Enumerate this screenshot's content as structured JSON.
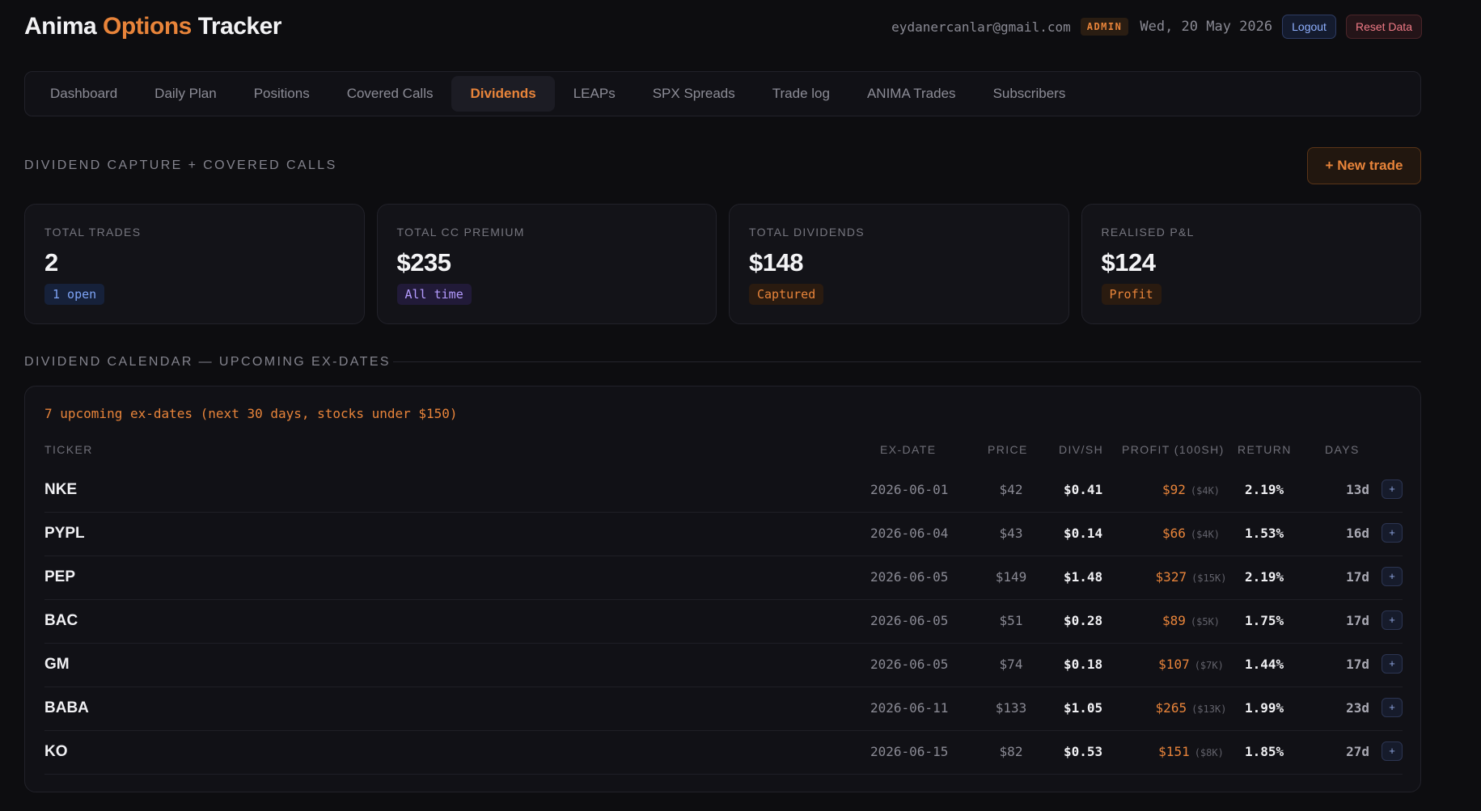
{
  "header": {
    "brand_part1": "Anima",
    "brand_part2": "Options",
    "brand_part3": "Tracker",
    "email": "eydanercanlar@gmail.com",
    "role_badge": "ADMIN",
    "date": "Wed, 20 May 2026",
    "logout_label": "Logout",
    "reset_label": "Reset Data"
  },
  "nav": {
    "tabs": [
      {
        "label": "Dashboard"
      },
      {
        "label": "Daily Plan"
      },
      {
        "label": "Positions"
      },
      {
        "label": "Covered Calls"
      },
      {
        "label": "Dividends",
        "active": true
      },
      {
        "label": "LEAPs"
      },
      {
        "label": "SPX Spreads"
      },
      {
        "label": "Trade log"
      },
      {
        "label": "ANIMA Trades"
      },
      {
        "label": "Subscribers"
      }
    ]
  },
  "section": {
    "title": "DIVIDEND CAPTURE + COVERED CALLS",
    "new_trade_label": "+ New trade"
  },
  "stats": [
    {
      "label": "TOTAL TRADES",
      "value": "2",
      "badge": "1 open"
    },
    {
      "label": "TOTAL CC PREMIUM",
      "value": "$235",
      "badge": "All time"
    },
    {
      "label": "TOTAL DIVIDENDS",
      "value": "$148",
      "badge": "Captured"
    },
    {
      "label": "REALISED P&L",
      "value": "$124",
      "badge": "Profit"
    }
  ],
  "calendar": {
    "title": "DIVIDEND CALENDAR — UPCOMING EX-DATES",
    "summary": "7 upcoming ex-dates (next 30 days, stocks under $150)",
    "columns": {
      "ticker": "TICKER",
      "exdate": "EX-DATE",
      "price": "PRICE",
      "divsh": "DIV/SH",
      "profit": "PROFIT (100SH)",
      "return": "RETURN",
      "days": "DAYS"
    },
    "rows": [
      {
        "ticker": "NKE",
        "exdate": "2026-06-01",
        "price": "$42",
        "divsh": "$0.41",
        "profit": "$92",
        "capital": "($4K)",
        "return": "2.19%",
        "days": "13d",
        "add": "+"
      },
      {
        "ticker": "PYPL",
        "exdate": "2026-06-04",
        "price": "$43",
        "divsh": "$0.14",
        "profit": "$66",
        "capital": "($4K)",
        "return": "1.53%",
        "days": "16d",
        "add": "+"
      },
      {
        "ticker": "PEP",
        "exdate": "2026-06-05",
        "price": "$149",
        "divsh": "$1.48",
        "profit": "$327",
        "capital": "($15K)",
        "return": "2.19%",
        "days": "17d",
        "add": "+"
      },
      {
        "ticker": "BAC",
        "exdate": "2026-06-05",
        "price": "$51",
        "divsh": "$0.28",
        "profit": "$89",
        "capital": "($5K)",
        "return": "1.75%",
        "days": "17d",
        "add": "+"
      },
      {
        "ticker": "GM",
        "exdate": "2026-06-05",
        "price": "$74",
        "divsh": "$0.18",
        "profit": "$107",
        "capital": "($7K)",
        "return": "1.44%",
        "days": "17d",
        "add": "+"
      },
      {
        "ticker": "BABA",
        "exdate": "2026-06-11",
        "price": "$133",
        "divsh": "$1.05",
        "profit": "$265",
        "capital": "($13K)",
        "return": "1.99%",
        "days": "23d",
        "add": "+"
      },
      {
        "ticker": "KO",
        "exdate": "2026-06-15",
        "price": "$82",
        "divsh": "$0.53",
        "profit": "$151",
        "capital": "($8K)",
        "return": "1.85%",
        "days": "27d",
        "add": "+"
      }
    ]
  },
  "colors": {
    "accent": "#e8843a",
    "background": "#0d0d10",
    "panel": "#111116"
  }
}
